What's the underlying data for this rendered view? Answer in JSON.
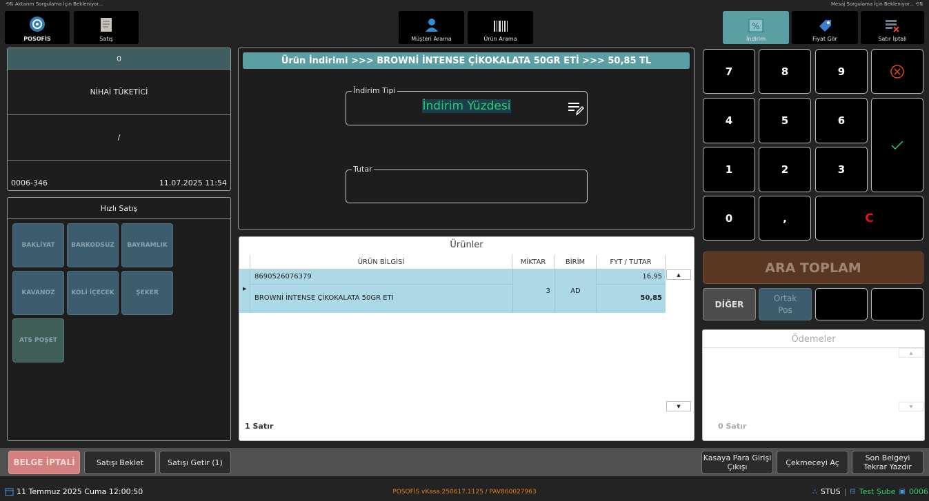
{
  "status_top": {
    "left": "Aktarım Sorgulama İçin Bekleniyor...",
    "right": "Mesaj Sorgulama İçin Bekleniyor..."
  },
  "toolbar": {
    "posofis": "POSOFİS",
    "satis": "Satış",
    "musteri_arama": "Müşteri Arama",
    "urun_arama": "Ürün Arama",
    "indirim": "İndirim",
    "fiyat_gor": "Fiyat Gör",
    "satir_iptali": "Satır İptali"
  },
  "customer": {
    "code": "0",
    "name": "NİHAİ TÜKETİCİ",
    "slash": "/",
    "doc_no": "0006-346",
    "datetime": "11.07.2025 11:54"
  },
  "quick_sale": {
    "title": "Hızlı Satış",
    "buttons": [
      "BAKLİYAT",
      "BARKODSUZ",
      "BAYRAMLIK",
      "KAVANOZ",
      "KOLİ İÇECEK",
      "ŞEKER",
      "ATS POŞET"
    ]
  },
  "discount": {
    "header": "Ürün İndirimi >>> BROWNİ İNTENSE ÇİKOKALATA 50GR ETİ >>> 50,85 TL",
    "type_label": "İndirim Tipi",
    "type_value": "İndirim Yüzdesi",
    "amount_label": "Tutar"
  },
  "products": {
    "title": "Ürünler",
    "columns": [
      "ÜRÜN BİLGİSİ",
      "MİKTAR",
      "BİRİM",
      "FYT / TUTAR"
    ],
    "rows": [
      {
        "barcode": "8690526076379",
        "name": "BROWNİ İNTENSE ÇİKOKALATA 50GR ETİ",
        "qty": "3",
        "unit": "AD",
        "price": "16,95",
        "total": "50,85"
      }
    ],
    "row_count": "1 Satır"
  },
  "keypad": {
    "keys": [
      "7",
      "8",
      "9",
      "4",
      "5",
      "6",
      "1",
      "2",
      "3",
      "0",
      ",",
      "C"
    ]
  },
  "totals": {
    "ara_toplam": "ARA TOPLAM",
    "diger": "DİĞER",
    "ortak_pos": "Ortak Pos"
  },
  "payments": {
    "title": "Ödemeler",
    "row_count": "0 Satır"
  },
  "bottom_bar": {
    "belge_iptali": "BELGE İPTALİ",
    "satisi_beklet": "Satışı Beklet",
    "satisi_getir": "Satışı Getir (1)",
    "kasaya_para": "Kasaya Para Girişi Çıkışı",
    "cekmeceyi_ac": "Çekmeceyi Aç",
    "son_belge": "Son Belgeyi Tekrar Yazdır"
  },
  "footer": {
    "date": "11 Temmuz 2025 Cuma 12:00:50",
    "version": "POSOFİS vKasa.250617.1125 / PAV860027963",
    "status": "STUS",
    "branch": "Test Şube",
    "register": "0006"
  },
  "colors": {
    "accent_teal": "#5b9fa5",
    "selected_row": "#add8e6",
    "green_text": "#2ecc71",
    "ara_toplam_bg": "#5a3723",
    "red_c": "#e3131b",
    "footer_orange": "#e0821f"
  }
}
